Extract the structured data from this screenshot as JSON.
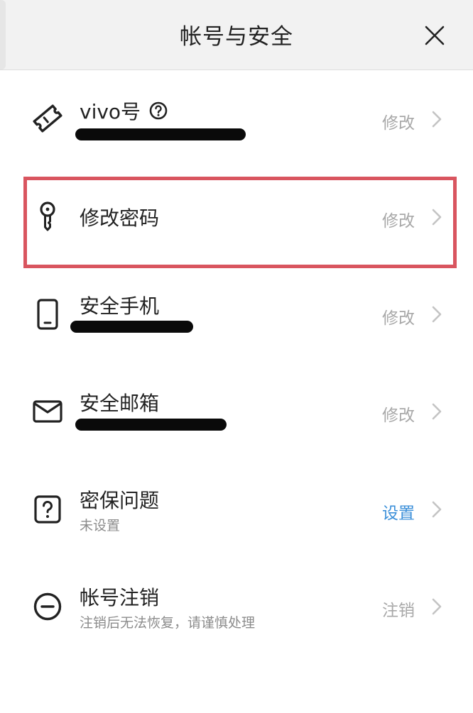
{
  "header": {
    "title": "帐号与安全",
    "close_icon": "close-icon"
  },
  "rows": [
    {
      "id": "vivo-id",
      "title": "vivo号",
      "subtitle": "",
      "action": "修改",
      "icon": "ticket-icon",
      "has_help": true,
      "value_redacted": true
    },
    {
      "id": "change-password",
      "title": "修改密码",
      "subtitle": "",
      "action": "修改",
      "icon": "key-icon",
      "highlighted": true
    },
    {
      "id": "security-phone",
      "title": "安全手机",
      "subtitle": "",
      "action": "修改",
      "icon": "phone-icon",
      "value_redacted": true
    },
    {
      "id": "security-email",
      "title": "安全邮箱",
      "subtitle": "",
      "action": "修改",
      "icon": "mail-icon",
      "value_redacted": true
    },
    {
      "id": "security-question",
      "title": "密保问题",
      "subtitle": "未设置",
      "action": "设置",
      "icon": "question-icon"
    },
    {
      "id": "cancel-account",
      "title": "帐号注销",
      "subtitle": "注销后无法恢复，请谨慎处理",
      "action": "注销",
      "icon": "minus-circle-icon"
    }
  ],
  "colors": {
    "header_bg": "#f2f2f2",
    "action_gray": "#a8a8a8",
    "action_blue": "#3b8fd9",
    "highlight_red": "#d9555f",
    "icon_dark": "#222222"
  }
}
